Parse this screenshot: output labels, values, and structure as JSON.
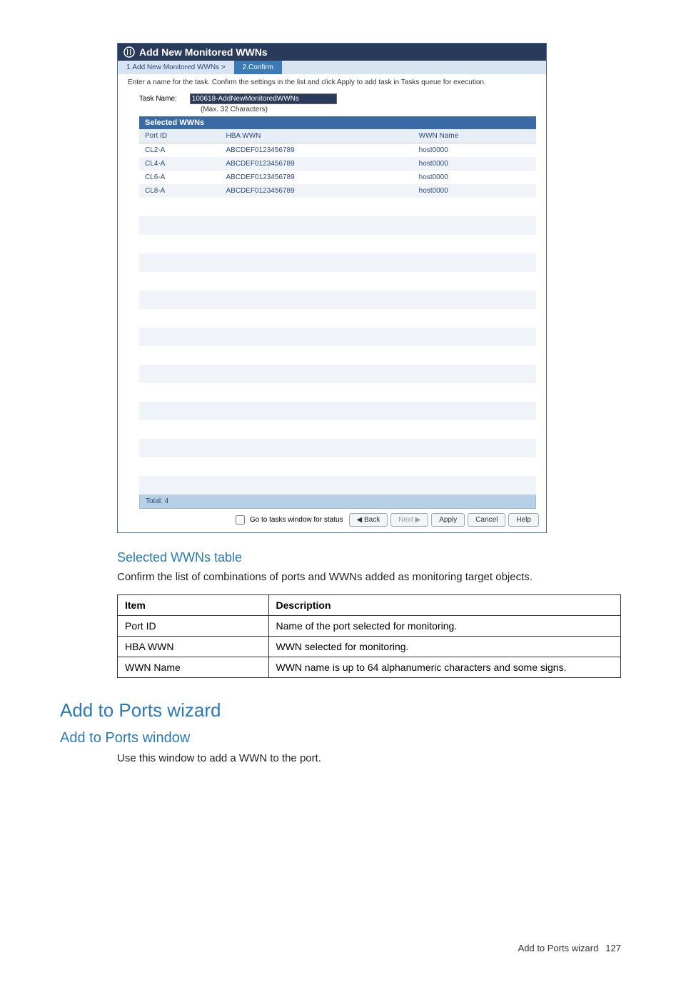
{
  "dialog": {
    "title": "Add New Monitored WWNs",
    "steps": {
      "step1": "1.Add New Monitored WWNs  >",
      "step2": "2.Confirm"
    },
    "instructions": "Enter a name for the task. Confirm the settings in the list and click Apply to add task in Tasks queue for execution.",
    "taskNameLabel": "Task Name:",
    "taskNameValue": "100618-AddNewMonitoredWWNs",
    "maxHint": "(Max. 32 Characters)",
    "tableTitle": "Selected WWNs",
    "columns": {
      "c1": "Port ID",
      "c2": "HBA WWN",
      "c3": "WWN Name"
    },
    "rows": [
      {
        "port": "CL2-A",
        "wwn": "ABCDEF0123456789",
        "name": "host0000"
      },
      {
        "port": "CL4-A",
        "wwn": "ABCDEF0123456789",
        "name": "host0000"
      },
      {
        "port": "CL6-A",
        "wwn": "ABCDEF0123456789",
        "name": "host0000"
      },
      {
        "port": "CL8-A",
        "wwn": "ABCDEF0123456789",
        "name": "host0000"
      }
    ],
    "total": "Total:  4",
    "goToTasks": "Go to tasks window for status",
    "buttons": {
      "back": "◀ Back",
      "next": "Next ▶",
      "apply": "Apply",
      "cancel": "Cancel",
      "help": "Help"
    }
  },
  "doc": {
    "selectedHeading": "Selected WWNs table",
    "selectedText": "Confirm the list of combinations of ports and WWNs added as monitoring target objects.",
    "descTable": {
      "h1": "Item",
      "h2": "Description",
      "rows": [
        {
          "item": "Port ID",
          "desc": "Name of the port selected for monitoring."
        },
        {
          "item": "HBA WWN",
          "desc": "WWN selected for monitoring."
        },
        {
          "item": "WWN Name",
          "desc": "WWN name is up to 64 alphanumeric characters and some signs."
        }
      ]
    },
    "h1": "Add to Ports wizard",
    "h2": "Add to Ports window",
    "body2": "Use this window to add a WWN to the port.",
    "footerLabel": "Add to Ports wizard",
    "pageNumber": "127"
  }
}
